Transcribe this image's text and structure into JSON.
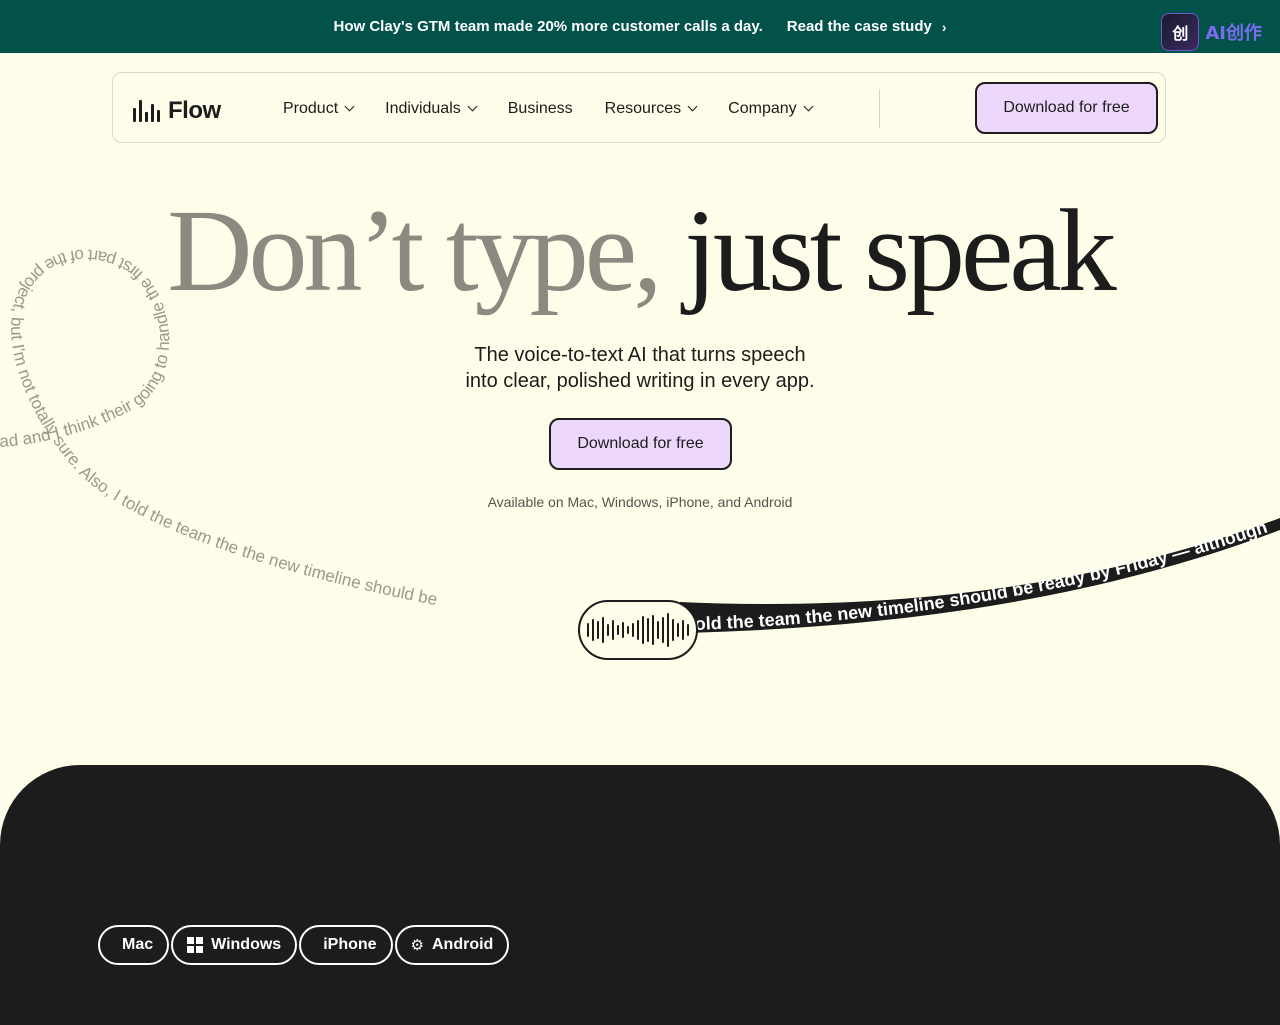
{
  "banner": {
    "text": "How Clay's GTM team made 20% more customer calls a day.",
    "link": "Read the case study",
    "badge_text": "AI创作"
  },
  "nav": {
    "logo": "Flow",
    "items": [
      {
        "label": "Product",
        "dropdown": true
      },
      {
        "label": "Individuals",
        "dropdown": true
      },
      {
        "label": "Business",
        "dropdown": false
      },
      {
        "label": "Resources",
        "dropdown": true
      },
      {
        "label": "Company",
        "dropdown": true
      }
    ],
    "cta": "Download for free"
  },
  "hero": {
    "headline_part1": "Don’t type,",
    "headline_part2": "just speak",
    "subtitle_line1": "The voice-to-text AI that turns speech",
    "subtitle_line2": "into clear, polished writing in every app.",
    "cta": "Download for free",
    "availability": "Available on Mac, Windows, iPhone, and Android"
  },
  "speech_flow": {
    "raw_text": "so I think their going to handle the first part of the project, but I'm not totally sure. Also, I told the team the the new timeline should be",
    "raw_text_prefix": "ad and I think their going to handle the first part of the project, but I'm not totally sure. Also, I told the team the the new timeline should be",
    "polished_text": "old the team the new timeline should be ready by Friday — although"
  },
  "platforms": [
    {
      "label": "Mac",
      "icon": "apple-icon"
    },
    {
      "label": "Windows",
      "icon": "windows-icon"
    },
    {
      "label": "iPhone",
      "icon": "apple-icon"
    },
    {
      "label": "Android",
      "icon": "android-icon"
    }
  ],
  "colors": {
    "banner_bg": "#02524a",
    "page_bg": "#fefde9",
    "button_bg": "#edd8fc",
    "dark": "#1c1c1c",
    "muted_text": "#8c8a80"
  }
}
